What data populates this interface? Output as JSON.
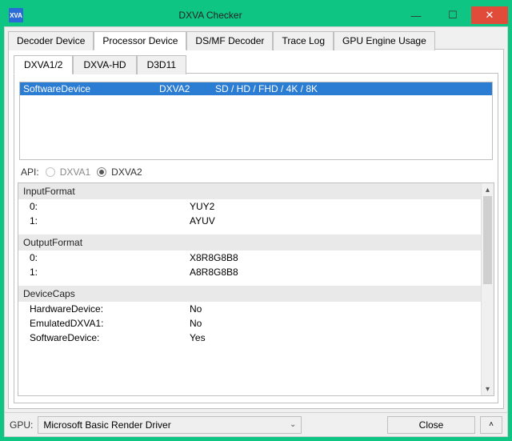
{
  "window": {
    "title": "DXVA Checker",
    "app_icon_text": "XVA"
  },
  "main_tabs": [
    {
      "label": "Decoder Device",
      "active": false
    },
    {
      "label": "Processor Device",
      "active": true
    },
    {
      "label": "DS/MF Decoder",
      "active": false
    },
    {
      "label": "Trace Log",
      "active": false
    },
    {
      "label": "GPU Engine Usage",
      "active": false
    }
  ],
  "sub_tabs": [
    {
      "label": "DXVA1/2",
      "active": true
    },
    {
      "label": "DXVA-HD",
      "active": false
    },
    {
      "label": "D3D11",
      "active": false
    }
  ],
  "device_list": {
    "rows": [
      {
        "name": "SoftwareDevice",
        "api": "DXVA2",
        "res": "SD / HD / FHD / 4K / 8K",
        "selected": true
      }
    ]
  },
  "api_row": {
    "label": "API:",
    "opt1": "DXVA1",
    "opt2": "DXVA2",
    "selected": "DXVA2",
    "opt1_enabled": false
  },
  "info": {
    "sections": [
      {
        "header": "InputFormat",
        "rows": [
          {
            "k": "0:",
            "v": "YUY2"
          },
          {
            "k": "1:",
            "v": "AYUV"
          }
        ]
      },
      {
        "header": "OutputFormat",
        "rows": [
          {
            "k": "0:",
            "v": "X8R8G8B8"
          },
          {
            "k": "1:",
            "v": "A8R8G8B8"
          }
        ]
      },
      {
        "header": "DeviceCaps",
        "rows": [
          {
            "k": "HardwareDevice:",
            "v": "No"
          },
          {
            "k": "EmulatedDXVA1:",
            "v": "No"
          },
          {
            "k": "SoftwareDevice:",
            "v": "Yes"
          }
        ]
      }
    ]
  },
  "bottom": {
    "gpu_label": "GPU:",
    "gpu_value": "Microsoft Basic Render Driver",
    "close_label": "Close"
  }
}
